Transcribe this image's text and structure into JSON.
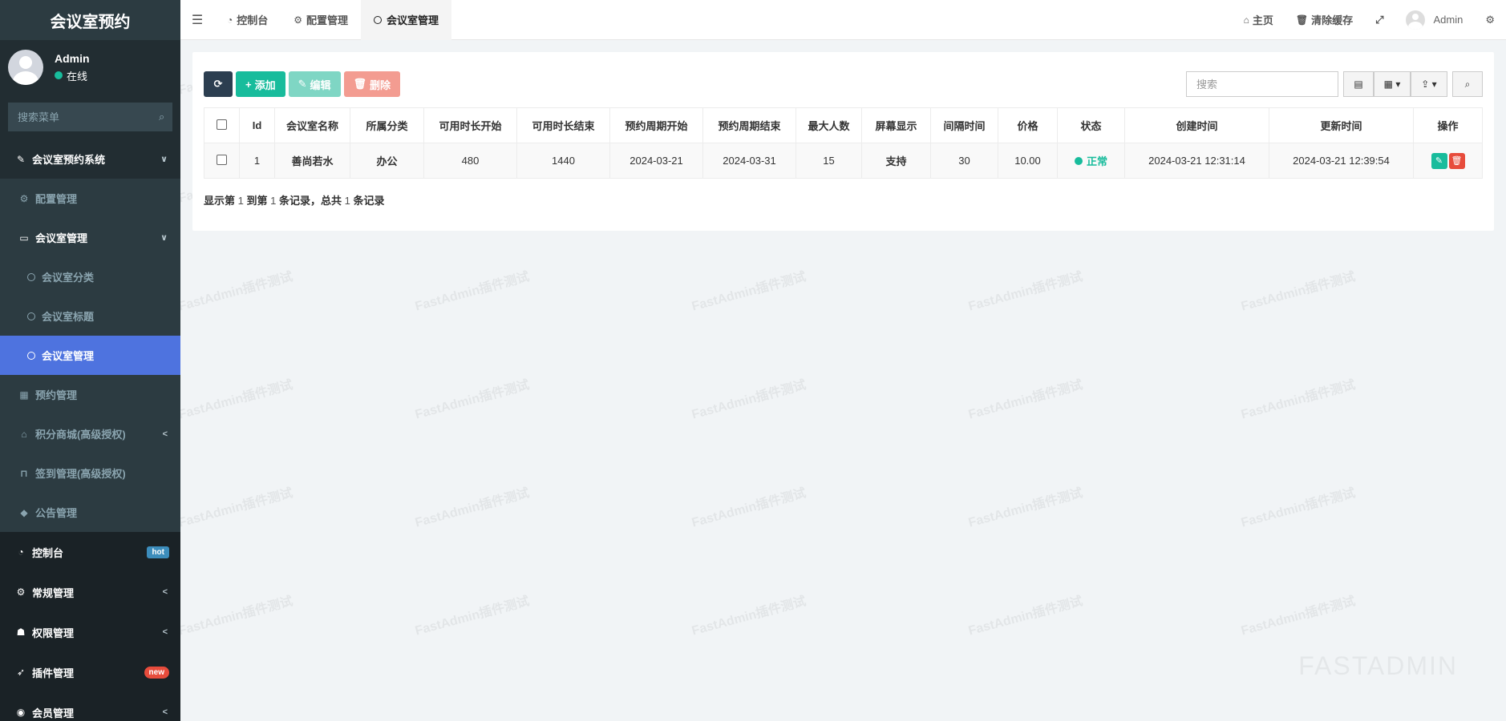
{
  "sidebar": {
    "title": "会议室预约",
    "user": {
      "name": "Admin",
      "status": "在线"
    },
    "search_placeholder": "搜索菜单",
    "items": [
      {
        "label": "会议室预约系统",
        "icon": "magic-wand-icon"
      },
      {
        "label": "配置管理",
        "icon": "gear-icon"
      },
      {
        "label": "会议室管理",
        "icon": "monitor-icon"
      },
      {
        "label": "会议室分类",
        "icon": "circle-icon"
      },
      {
        "label": "会议室标题",
        "icon": "circle-icon"
      },
      {
        "label": "会议室管理",
        "icon": "circle-icon"
      },
      {
        "label": "预约管理",
        "icon": "table-icon"
      },
      {
        "label": "积分商城(高级授权)",
        "icon": "basket-icon"
      },
      {
        "label": "签到管理(高级授权)",
        "icon": "bookmark-icon"
      },
      {
        "label": "公告管理",
        "icon": "tag-icon"
      },
      {
        "label": "控制台",
        "icon": "dashboard-icon",
        "badge": "hot"
      },
      {
        "label": "常规管理",
        "icon": "gears-icon"
      },
      {
        "label": "权限管理",
        "icon": "group-icon"
      },
      {
        "label": "插件管理",
        "icon": "rocket-icon",
        "badge": "new"
      },
      {
        "label": "会员管理",
        "icon": "user-icon"
      }
    ]
  },
  "topbar": {
    "tabs": [
      {
        "label": "控制台",
        "icon": "dashboard-icon"
      },
      {
        "label": "配置管理",
        "icon": "gear-icon"
      },
      {
        "label": "会议室管理",
        "icon": "circle-icon"
      }
    ],
    "home": "主页",
    "clear_cache": "清除缓存",
    "user": "Admin"
  },
  "toolbar": {
    "add": "添加",
    "edit": "编辑",
    "delete": "删除",
    "search_placeholder": "搜索"
  },
  "table": {
    "headers": [
      "Id",
      "会议室名称",
      "所属分类",
      "可用时长开始",
      "可用时长结束",
      "预约周期开始",
      "预约周期结束",
      "最大人数",
      "屏幕显示",
      "间隔时间",
      "价格",
      "状态",
      "创建时间",
      "更新时间",
      "操作"
    ],
    "rows": [
      {
        "id": "1",
        "name": "善尚若水",
        "category": "办公",
        "start": "480",
        "end": "1440",
        "period_start": "2024-03-21",
        "period_end": "2024-03-31",
        "max": "15",
        "screen": "支持",
        "interval": "30",
        "price": "10.00",
        "status": "正常",
        "created": "2024-03-21 12:31:14",
        "updated": "2024-03-21 12:39:54"
      }
    ]
  },
  "summary": {
    "p1": "显示第",
    "from": "1",
    "p2": "到第",
    "to": "1",
    "p3": "条记录，总共",
    "total": "1",
    "p4": "条记录"
  },
  "watermark": "FastAdmin插件测试",
  "brand": "FASTADMIN",
  "colors": {
    "accent": "#4e73df",
    "success": "#18bc9c",
    "danger": "#e74c3c",
    "sidebar": "#222d32"
  }
}
